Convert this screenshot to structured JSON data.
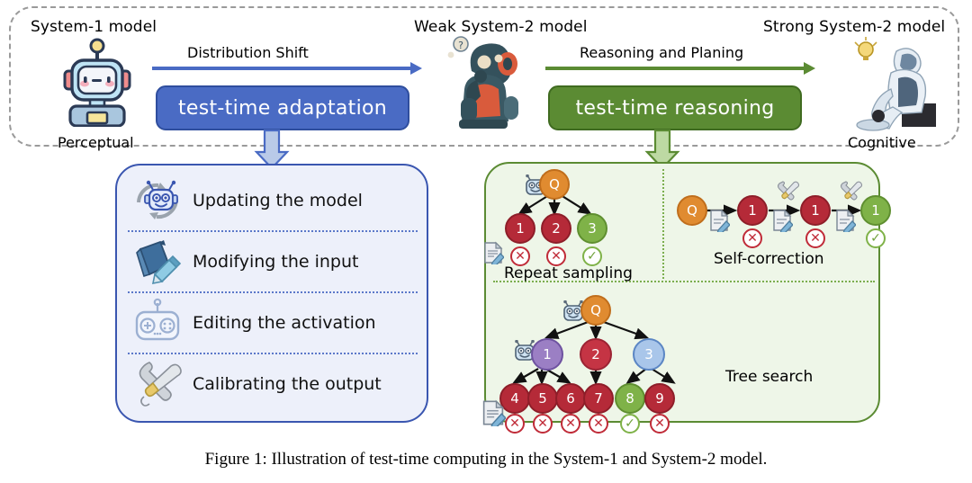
{
  "figure": {
    "caption": "Figure 1: Illustration of test-time computing in the System-1 and System-2 model."
  },
  "pipeline": {
    "stages": [
      {
        "title": "System-1 model",
        "caption": "Perceptual",
        "icon": "cute-robot-icon"
      },
      {
        "title": "Weak System-2 model",
        "caption": "",
        "icon": "thinking-robot-icon"
      },
      {
        "title": "Strong System-2 model",
        "caption": "Cognitive",
        "icon": "sitting-robot-icon"
      }
    ],
    "transitions": [
      {
        "arrow_label": "Distribution Shift",
        "button_label": "test-time adaptation",
        "color": "#4A6BC4"
      },
      {
        "arrow_label": "Reasoning and Planing",
        "button_label": "test-time reasoning",
        "color": "#5B8B33"
      }
    ]
  },
  "left_panel": {
    "accent": "#3A56B0",
    "background": "#EDF0FA",
    "items": [
      {
        "label": "Updating the model",
        "icon": "robot-refresh-icon"
      },
      {
        "label": "Modifying the input",
        "icon": "book-pencil-icon"
      },
      {
        "label": "Editing the activation",
        "icon": "gamepad-icon"
      },
      {
        "label": "Calibrating the output",
        "icon": "wrench-screwdriver-icon"
      }
    ]
  },
  "right_panel": {
    "accent": "#5B8B33",
    "background": "#EEF6E8",
    "sections": [
      {
        "label": "Repeat sampling",
        "root": "Q",
        "nodes": [
          {
            "label": "1",
            "color": "red",
            "status": "wrong"
          },
          {
            "label": "2",
            "color": "red",
            "status": "wrong"
          },
          {
            "label": "3",
            "color": "green",
            "status": "right"
          }
        ]
      },
      {
        "label": "Self-correction",
        "root": "Q",
        "nodes": [
          {
            "label": "1",
            "color": "red",
            "status": "wrong"
          },
          {
            "label": "1",
            "color": "red",
            "status": "wrong"
          },
          {
            "label": "1",
            "color": "green",
            "status": "right"
          }
        ]
      },
      {
        "label": "Tree search",
        "root": "Q",
        "level1": [
          {
            "label": "1",
            "color": "purple"
          },
          {
            "label": "2",
            "color": "red"
          },
          {
            "label": "3",
            "color": "blue"
          }
        ],
        "level2": [
          {
            "label": "4",
            "color": "red",
            "status": "wrong"
          },
          {
            "label": "5",
            "color": "red",
            "status": "wrong"
          },
          {
            "label": "6",
            "color": "red",
            "status": "wrong"
          },
          {
            "label": "7",
            "color": "red",
            "status": "wrong"
          },
          {
            "label": "8",
            "color": "green",
            "status": "right"
          },
          {
            "label": "9",
            "color": "red",
            "status": "wrong"
          }
        ]
      }
    ]
  },
  "marks": {
    "wrong": "✕",
    "right": "✓"
  }
}
